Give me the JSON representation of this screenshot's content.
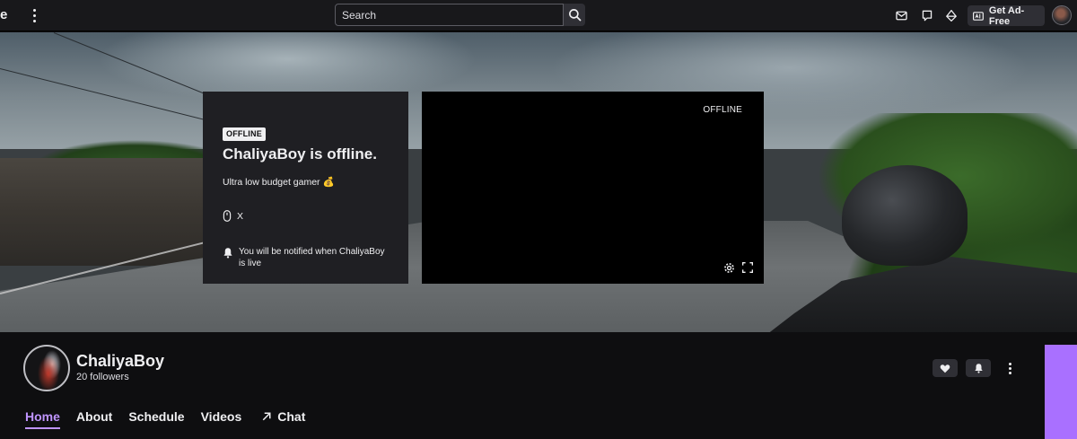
{
  "topnav": {
    "partial_logo_text": "e",
    "search": {
      "placeholder": "Search"
    },
    "get_ad_free_label": "Get Ad-Free",
    "icons": [
      "more-vertical-icon",
      "search-icon",
      "inbox-icon",
      "whispers-icon",
      "prime-crown-icon",
      "ad-free-icon",
      "user-avatar"
    ]
  },
  "offline_card": {
    "badge": "OFFLINE",
    "title": "ChaliyaBoy is offline.",
    "description": "Ultra low budget gamer 💰",
    "social_label": "X",
    "notify_text": "You will be notified when ChaliyaBoy is live"
  },
  "player": {
    "status": "OFFLINE"
  },
  "channel": {
    "name": "ChaliyaBoy",
    "followers": "20 followers"
  },
  "tabs": [
    {
      "label": "Home",
      "active": true
    },
    {
      "label": "About",
      "active": false
    },
    {
      "label": "Schedule",
      "active": false
    },
    {
      "label": "Videos",
      "active": false
    },
    {
      "label": "Chat",
      "active": false
    }
  ],
  "colors": {
    "accent": "#bf94ff",
    "accent_strip": "#a970ff",
    "background": "#0e0e10",
    "surface": "#1f1f23",
    "button": "#2f2f35"
  }
}
